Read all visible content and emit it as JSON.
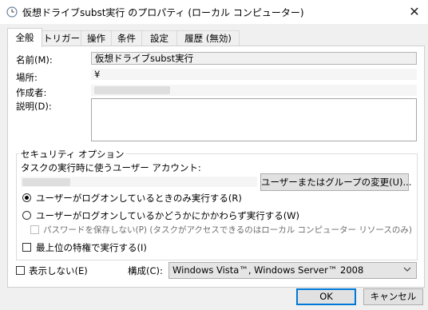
{
  "window": {
    "title": "仮想ドライブsubst実行 のプロパティ (ローカル コンピューター)",
    "close_glyph": "✕",
    "icon": "clock-icon"
  },
  "tabs": [
    {
      "label": "全般",
      "active": true
    },
    {
      "label": "トリガー",
      "active": false
    },
    {
      "label": "操作",
      "active": false
    },
    {
      "label": "条件",
      "active": false
    },
    {
      "label": "設定",
      "active": false
    },
    {
      "label": "履歴 (無効)",
      "active": false
    }
  ],
  "general": {
    "name_label": "名前(M):",
    "name_value": "仮想ドライブsubst実行",
    "location_label": "場所:",
    "location_value": "¥",
    "author_label": "作成者:",
    "description_label": "説明(D):",
    "description_value": ""
  },
  "security": {
    "group_title": "セキュリティ オプション",
    "account_prompt": "タスクの実行時に使うユーザー アカウント:",
    "change_button": "ユーザーまたはグループの変更(U)...",
    "radio_logged_on": "ユーザーがログオンしているときのみ実行する(R)",
    "radio_whether": "ユーザーがログオンしているかどうかにかかわらず実行する(W)",
    "no_store_password": "パスワードを保存しない(P) (タスクがアクセスできるのはローカル コンピューター リソースのみ)",
    "highest_privileges": "最上位の特権で実行する(I)",
    "selected_radio": "logged_on"
  },
  "footer": {
    "hidden_label": "表示しない(E)",
    "configure_label": "構成(C):",
    "configure_value": "Windows Vista™, Windows Server™ 2008"
  },
  "buttons": {
    "ok": "OK",
    "cancel": "キャンセル"
  },
  "colors": {
    "accent": "#0078d7",
    "window_bg": "#f0f0f0"
  }
}
